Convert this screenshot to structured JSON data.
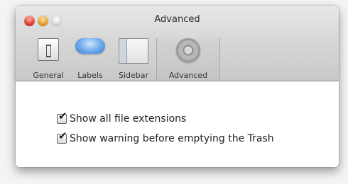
{
  "window": {
    "title": "Advanced"
  },
  "toolbar": {
    "items": [
      {
        "label": "General",
        "icon": "general-icon"
      },
      {
        "label": "Labels",
        "icon": "labels-icon"
      },
      {
        "label": "Sidebar",
        "icon": "sidebar-icon"
      },
      {
        "label": "Advanced",
        "icon": "gear-icon",
        "selected": true
      }
    ]
  },
  "options": {
    "show_extensions": {
      "label": "Show all file extensions",
      "checked": true
    },
    "trash_warning": {
      "label": "Show warning before emptying the Trash",
      "checked": true
    }
  },
  "icons": {
    "checkmark": "✔"
  },
  "colors": {
    "close": "#d8392a",
    "minimize": "#e09a2a",
    "zoom": "#d6d6d6",
    "labels_blue": "#6aa6ea"
  }
}
